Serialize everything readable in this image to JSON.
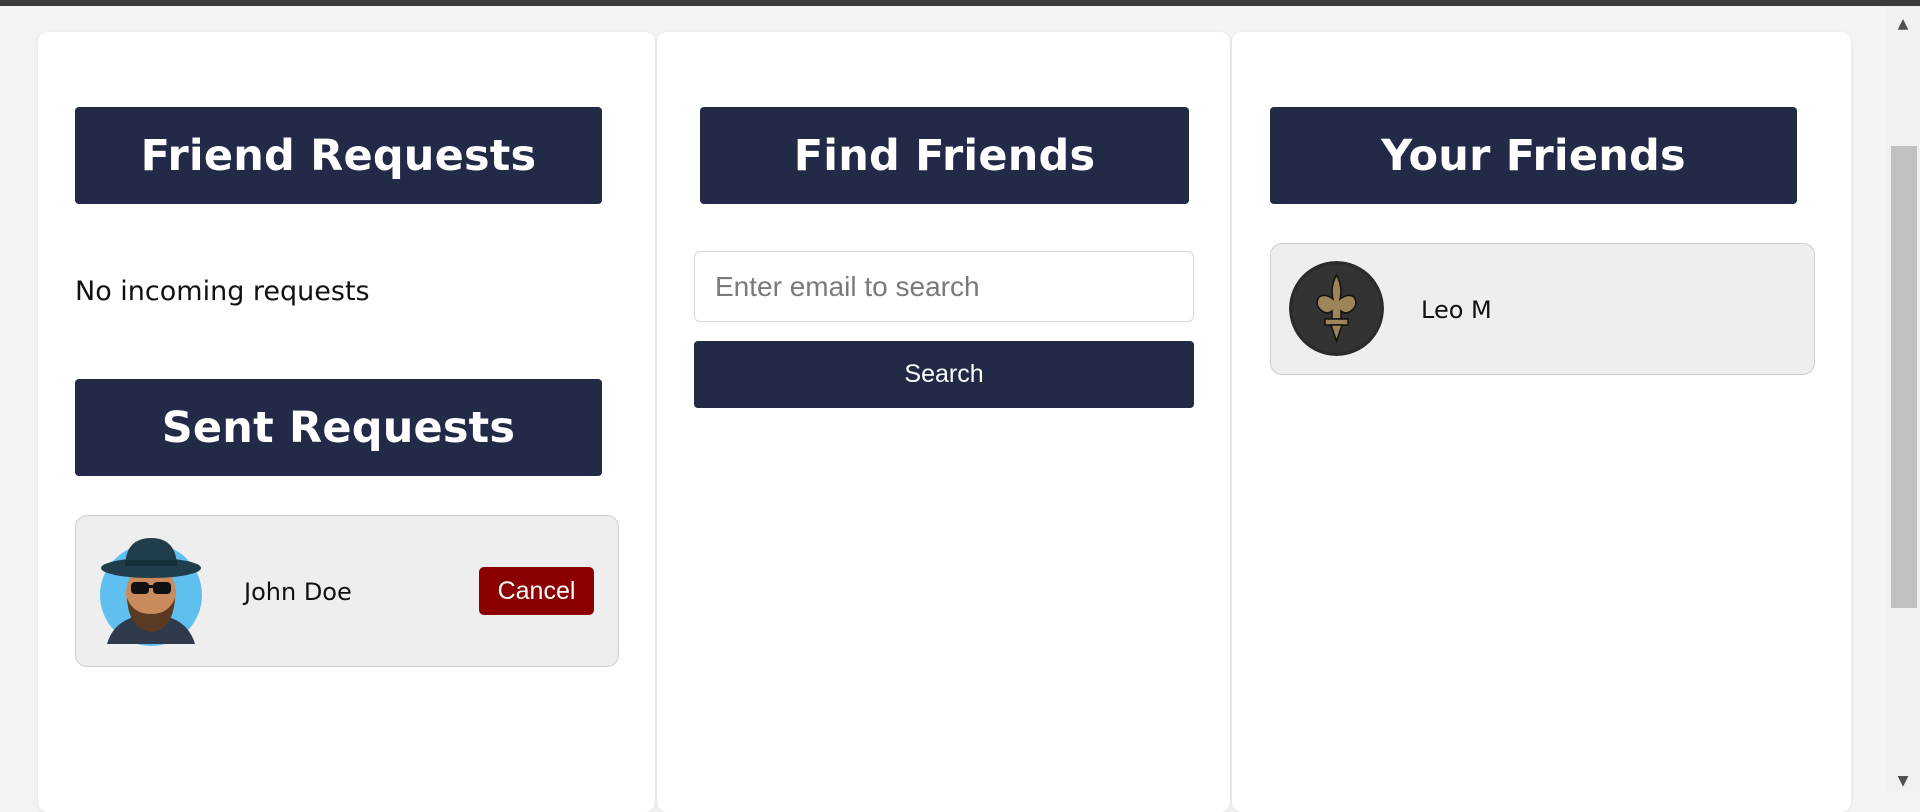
{
  "friend_requests": {
    "title": "Friend Requests",
    "empty_text": "No incoming requests"
  },
  "sent_requests": {
    "title": "Sent Requests",
    "items": [
      {
        "name": "John Doe",
        "action_label": "Cancel"
      }
    ]
  },
  "find_friends": {
    "title": "Find Friends",
    "search_placeholder": "Enter email to search",
    "search_value": "",
    "search_button_label": "Search"
  },
  "your_friends": {
    "title": "Your Friends",
    "items": [
      {
        "name": "Leo M"
      }
    ]
  },
  "scrollbar": {
    "up_icon": "▲",
    "down_icon": "▼"
  },
  "colors": {
    "header_bg": "#222a48",
    "cancel_bg": "#8b0000",
    "card_bg": "#eeeeee",
    "page_bg": "#f3f3f3"
  }
}
